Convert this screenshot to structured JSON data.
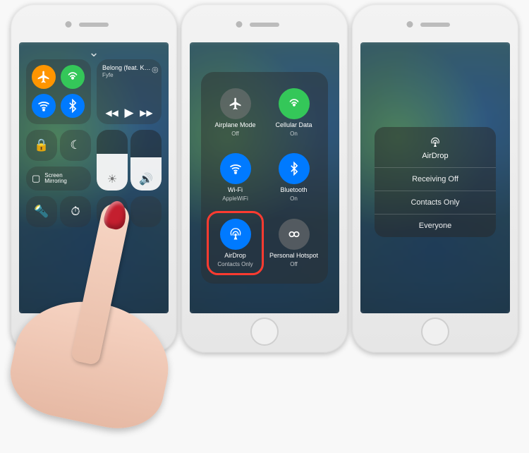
{
  "phone1": {
    "media": {
      "title": "Belong (feat. Ki…",
      "artist": "Fyfe"
    },
    "mirror_label": "Screen\nMirroring",
    "brightness_pct": 60,
    "volume_pct": 55
  },
  "phone2": {
    "items": [
      {
        "name": "airplane",
        "label": "Airplane Mode",
        "sub": "Off",
        "color": "gray"
      },
      {
        "name": "cellular",
        "label": "Cellular Data",
        "sub": "On",
        "color": "green"
      },
      {
        "name": "wifi",
        "label": "Wi-Fi",
        "sub": "AppleWiFi",
        "color": "blue"
      },
      {
        "name": "bluetooth",
        "label": "Bluetooth",
        "sub": "On",
        "color": "blue"
      },
      {
        "name": "airdrop",
        "label": "AirDrop",
        "sub": "Contacts Only",
        "color": "blue",
        "highlight": true
      },
      {
        "name": "hotspot",
        "label": "Personal Hotspot",
        "sub": "Off",
        "color": "gray"
      }
    ]
  },
  "phone3": {
    "title": "AirDrop",
    "options": [
      "Receiving Off",
      "Contacts Only",
      "Everyone"
    ]
  }
}
